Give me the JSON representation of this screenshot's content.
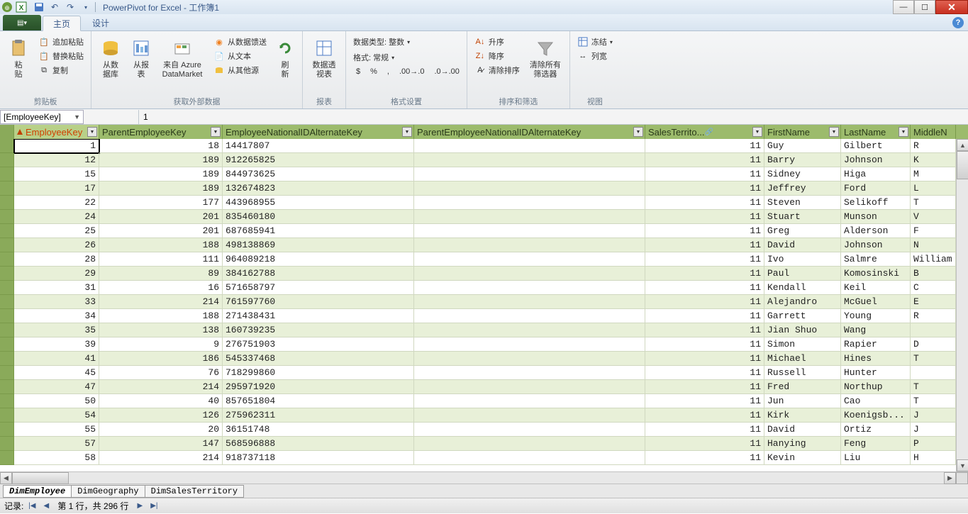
{
  "title": "PowerPivot for Excel - 工作簿1",
  "tabs": {
    "file": "▾",
    "home": "主页",
    "design": "设计"
  },
  "ribbon": {
    "clipboard": {
      "label": "剪贴板",
      "paste": "粘\n贴",
      "addpaste": "追加粘贴",
      "replacepaste": "替换粘贴",
      "copy": "复制"
    },
    "external": {
      "label": "获取外部数据",
      "fromdb": "从数\n据库",
      "fromreport": "从报\n表",
      "fromazure": "来自 Azure\nDataMarket",
      "fromfeed": "从数据馈送",
      "fromtext": "从文本",
      "fromother": "从其他源"
    },
    "refresh": {
      "label": "报表",
      "refresh": "刷\n新",
      "pivot": "数据透\n视表"
    },
    "format": {
      "label": "格式设置",
      "datatype": "数据类型: 整数",
      "formatsel": "格式: 常规",
      "symbols": [
        "$",
        "%",
        ","
      ]
    },
    "sortfilter": {
      "label": "排序和筛选",
      "asc": "升序",
      "desc": "降序",
      "clear": "清除排序",
      "clearfilter": "清除所有\n筛选器"
    },
    "view": {
      "label": "视图",
      "freeze": "冻结",
      "colwidth": "列宽"
    }
  },
  "formulabar": {
    "namebox": "[EmployeeKey]",
    "value": "1"
  },
  "columns": [
    "EmployeeKey",
    "ParentEmployeeKey",
    "EmployeeNationalIDAlternateKey",
    "ParentEmployeeNationalIDAlternateKey",
    "SalesTerrito...",
    "FirstName",
    "LastName",
    "MiddleN"
  ],
  "rows": [
    {
      "ek": 1,
      "pek": 18,
      "nid": "14417807",
      "pnid": "",
      "st": 11,
      "fn": "Guy",
      "ln": "Gilbert",
      "mn": "R"
    },
    {
      "ek": 12,
      "pek": 189,
      "nid": "912265825",
      "pnid": "",
      "st": 11,
      "fn": "Barry",
      "ln": "Johnson",
      "mn": "K"
    },
    {
      "ek": 15,
      "pek": 189,
      "nid": "844973625",
      "pnid": "",
      "st": 11,
      "fn": "Sidney",
      "ln": "Higa",
      "mn": "M"
    },
    {
      "ek": 17,
      "pek": 189,
      "nid": "132674823",
      "pnid": "",
      "st": 11,
      "fn": "Jeffrey",
      "ln": "Ford",
      "mn": "L"
    },
    {
      "ek": 22,
      "pek": 177,
      "nid": "443968955",
      "pnid": "",
      "st": 11,
      "fn": "Steven",
      "ln": "Selikoff",
      "mn": "T"
    },
    {
      "ek": 24,
      "pek": 201,
      "nid": "835460180",
      "pnid": "",
      "st": 11,
      "fn": "Stuart",
      "ln": "Munson",
      "mn": "V"
    },
    {
      "ek": 25,
      "pek": 201,
      "nid": "687685941",
      "pnid": "",
      "st": 11,
      "fn": "Greg",
      "ln": "Alderson",
      "mn": "F"
    },
    {
      "ek": 26,
      "pek": 188,
      "nid": "498138869",
      "pnid": "",
      "st": 11,
      "fn": "David",
      "ln": "Johnson",
      "mn": "N"
    },
    {
      "ek": 28,
      "pek": 111,
      "nid": "964089218",
      "pnid": "",
      "st": 11,
      "fn": "Ivo",
      "ln": "Salmre",
      "mn": "William"
    },
    {
      "ek": 29,
      "pek": 89,
      "nid": "384162788",
      "pnid": "",
      "st": 11,
      "fn": "Paul",
      "ln": "Komosinski",
      "mn": "B"
    },
    {
      "ek": 31,
      "pek": 16,
      "nid": "571658797",
      "pnid": "",
      "st": 11,
      "fn": "Kendall",
      "ln": "Keil",
      "mn": "C"
    },
    {
      "ek": 33,
      "pek": 214,
      "nid": "761597760",
      "pnid": "",
      "st": 11,
      "fn": "Alejandro",
      "ln": "McGuel",
      "mn": "E"
    },
    {
      "ek": 34,
      "pek": 188,
      "nid": "271438431",
      "pnid": "",
      "st": 11,
      "fn": "Garrett",
      "ln": "Young",
      "mn": "R"
    },
    {
      "ek": 35,
      "pek": 138,
      "nid": "160739235",
      "pnid": "",
      "st": 11,
      "fn": "Jian Shuo",
      "ln": "Wang",
      "mn": ""
    },
    {
      "ek": 39,
      "pek": 9,
      "nid": "276751903",
      "pnid": "",
      "st": 11,
      "fn": "Simon",
      "ln": "Rapier",
      "mn": "D"
    },
    {
      "ek": 41,
      "pek": 186,
      "nid": "545337468",
      "pnid": "",
      "st": 11,
      "fn": "Michael",
      "ln": "Hines",
      "mn": "T"
    },
    {
      "ek": 45,
      "pek": 76,
      "nid": "718299860",
      "pnid": "",
      "st": 11,
      "fn": "Russell",
      "ln": "Hunter",
      "mn": ""
    },
    {
      "ek": 47,
      "pek": 214,
      "nid": "295971920",
      "pnid": "",
      "st": 11,
      "fn": "Fred",
      "ln": "Northup",
      "mn": "T"
    },
    {
      "ek": 50,
      "pek": 40,
      "nid": "857651804",
      "pnid": "",
      "st": 11,
      "fn": "Jun",
      "ln": "Cao",
      "mn": "T"
    },
    {
      "ek": 54,
      "pek": 126,
      "nid": "275962311",
      "pnid": "",
      "st": 11,
      "fn": "Kirk",
      "ln": "Koenigsb...",
      "mn": "J"
    },
    {
      "ek": 55,
      "pek": 20,
      "nid": "36151748",
      "pnid": "",
      "st": 11,
      "fn": "David",
      "ln": "Ortiz",
      "mn": "J"
    },
    {
      "ek": 57,
      "pek": 147,
      "nid": "568596888",
      "pnid": "",
      "st": 11,
      "fn": "Hanying",
      "ln": "Feng",
      "mn": "P"
    },
    {
      "ek": 58,
      "pek": 214,
      "nid": "918737118",
      "pnid": "",
      "st": 11,
      "fn": "Kevin",
      "ln": "Liu",
      "mn": "H"
    }
  ],
  "sheets": [
    "DimEmployee",
    "DimGeography",
    "DimSalesTerritory"
  ],
  "status": {
    "label": "记录:",
    "pos": "第 1 行，共 296 行"
  }
}
